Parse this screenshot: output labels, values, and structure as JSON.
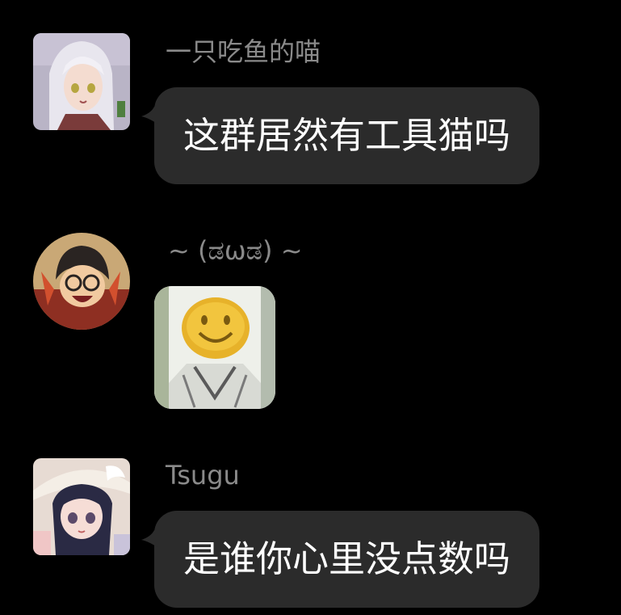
{
  "messages": [
    {
      "sender": "一只吃鱼的喵",
      "avatar_icon": "anime-girl-avatar-icon",
      "text": "这群居然有工具猫吗"
    },
    {
      "sender": "~ (ಡωಡ) ~",
      "avatar_icon": "detective-boy-avatar-icon",
      "sticker": "smiley-face-sticker"
    },
    {
      "sender": "Tsugu",
      "avatar_icon": "hat-girl-avatar-icon",
      "text": "是谁你心里没点数吗"
    }
  ],
  "colors": {
    "background": "#000000",
    "bubble": "#2b2b2b",
    "nickname": "#8a8a8a",
    "message_text": "#ffffff"
  }
}
